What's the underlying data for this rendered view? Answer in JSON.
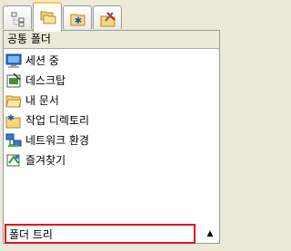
{
  "panel": {
    "header_title": "공통 폴더",
    "items": [
      {
        "label": "세션 중",
        "icon": "monitor-icon"
      },
      {
        "label": "데스크탑",
        "icon": "desktop-icon"
      },
      {
        "label": "내 문서",
        "icon": "open-folder-icon"
      },
      {
        "label": "작업 디렉토리",
        "icon": "star-folder-icon"
      },
      {
        "label": "네트워크 환경",
        "icon": "network-icon"
      },
      {
        "label": "즐겨찾기",
        "icon": "favorites-icon"
      }
    ],
    "footer_label": "폴더 트리",
    "footer_highlight_color": "#E0101E"
  },
  "tabs": [
    {
      "icon": "tree-icon"
    },
    {
      "icon": "folders-icon"
    },
    {
      "icon": "star-folder-icon"
    },
    {
      "icon": "tools-icon"
    }
  ]
}
